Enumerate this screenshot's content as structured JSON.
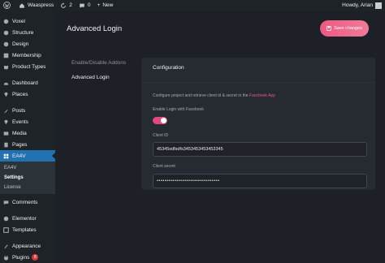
{
  "adminbar": {
    "site_name": "Waaspress",
    "updates_count": "2",
    "comments_count": "0",
    "new_label": "New",
    "howdy": "Howdy, Arian"
  },
  "sidebar": {
    "items": [
      {
        "label": "Voxel",
        "icon": "voxel-icon"
      },
      {
        "label": "Structure",
        "icon": "structure-icon"
      },
      {
        "label": "Design",
        "icon": "design-icon"
      },
      {
        "label": "Membership",
        "icon": "membership-icon"
      },
      {
        "label": "Product Types",
        "icon": "product-types-icon"
      },
      {
        "label": "Dashboard",
        "icon": "dashboard-icon"
      },
      {
        "label": "Places",
        "icon": "places-icon"
      },
      {
        "label": "Posts",
        "icon": "posts-icon"
      },
      {
        "label": "Events",
        "icon": "events-icon"
      },
      {
        "label": "Media",
        "icon": "media-icon"
      },
      {
        "label": "Pages",
        "icon": "pages-icon"
      },
      {
        "label": "EA4V",
        "icon": "ea4v-icon"
      },
      {
        "label": "Comments",
        "icon": "comments-icon"
      },
      {
        "label": "Elementor",
        "icon": "elementor-icon"
      },
      {
        "label": "Templates",
        "icon": "templates-icon"
      },
      {
        "label": "Appearance",
        "icon": "appearance-icon"
      },
      {
        "label": "Plugins",
        "icon": "plugins-icon",
        "badge": "8"
      }
    ],
    "submenu": [
      "EA4V",
      "Settings",
      "License"
    ]
  },
  "page": {
    "title": "Advanced Login",
    "save_label": "Save changes"
  },
  "tabs": [
    "Enable/Disable Addons",
    "Advanced Login"
  ],
  "panel": {
    "title": "Configuration",
    "description": "Configure project and retrieve client id & secret in the",
    "link_text": "Facebook App",
    "toggle_label": "Enable Login with Facebook",
    "toggle_on": true,
    "client_id_label": "Client ID",
    "client_id_value": "45345sdfsdfs3453453453453345",
    "client_secret_label": "Client secret",
    "client_secret_value": "••••••••••••••••••••••••••••••••"
  },
  "colors": {
    "accent": "#e24a7f",
    "admin_active": "#2271b1",
    "background": "#1d2026"
  }
}
